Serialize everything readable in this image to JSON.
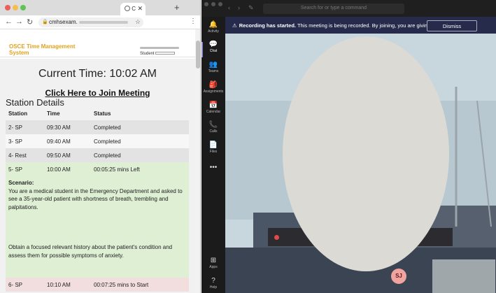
{
  "browser": {
    "tab_title": "C",
    "url_text": "cmhsexam.",
    "new_tab_symbol": "+",
    "tab_close_symbol": "✕",
    "back_symbol": "←",
    "forward_symbol": "→",
    "reload_symbol": "↻",
    "lock_symbol": "🔒",
    "star_symbol": "☆",
    "menu_symbol": "⋮"
  },
  "site": {
    "brand": "OSCE Time Management System",
    "student_label": "Student",
    "current_time": "Current Time: 10:02 AM",
    "join_link": "Click Here to Join Meeting",
    "section_title": "Station Details",
    "columns": [
      "Station",
      "Time",
      "Status"
    ],
    "rows": [
      {
        "station": "2- SP",
        "time": "09:30 AM",
        "status": "Completed",
        "style": "gray"
      },
      {
        "station": "3- SP",
        "time": "09:40 AM",
        "status": "Completed",
        "style": "white"
      },
      {
        "station": "4- Rest",
        "time": "09:50 AM",
        "status": "Completed",
        "style": "gray"
      },
      {
        "station": "5- SP",
        "time": "10:00 AM",
        "status": "00:05:25 mins Left",
        "style": "green"
      }
    ],
    "scenario_label": "Scenario:",
    "scenario_text": "You are a medical student in the Emergency Department and asked to see a 35-year-old patient with shortness of breath, trembling and palpitations.",
    "scenario_task": "Obtain a focused relevant history about the patient's condition and assess them for possible symptoms of anxiety.",
    "next_row": {
      "station": "6- SP",
      "time": "10:10 AM",
      "status": "00:07:25 mins to Start"
    }
  },
  "teams": {
    "search_placeholder": "Search for or type a command",
    "rail": [
      {
        "label": "Activity",
        "icon": "bell-icon",
        "glyph": "🔔"
      },
      {
        "label": "Chat",
        "icon": "chat-icon",
        "glyph": "💬"
      },
      {
        "label": "Teams",
        "icon": "teams-icon",
        "glyph": "👥"
      },
      {
        "label": "Assignments",
        "icon": "assignments-icon",
        "glyph": "🎒"
      },
      {
        "label": "Calendar",
        "icon": "calendar-icon",
        "glyph": "📅"
      },
      {
        "label": "Calls",
        "icon": "phone-icon",
        "glyph": "📞"
      },
      {
        "label": "Files",
        "icon": "file-icon",
        "glyph": "📄"
      },
      {
        "label": "",
        "icon": "more-icon",
        "glyph": "•••"
      },
      {
        "label": "Apps",
        "icon": "apps-icon",
        "glyph": "⊞"
      },
      {
        "label": "Help",
        "icon": "help-icon",
        "glyph": "?"
      }
    ],
    "banner_bold": "Recording has started.",
    "banner_text": "This meeting is being recorded. By joining, you are giving co...",
    "dismiss_label": "Dismiss",
    "avatar_initials": "SJ",
    "hangup_glyph": "☎",
    "colors": {
      "banner": "#262a4b",
      "hangup": "#c4314b",
      "avatar": "#f1a3a0",
      "brand": "#e4a21c"
    }
  }
}
